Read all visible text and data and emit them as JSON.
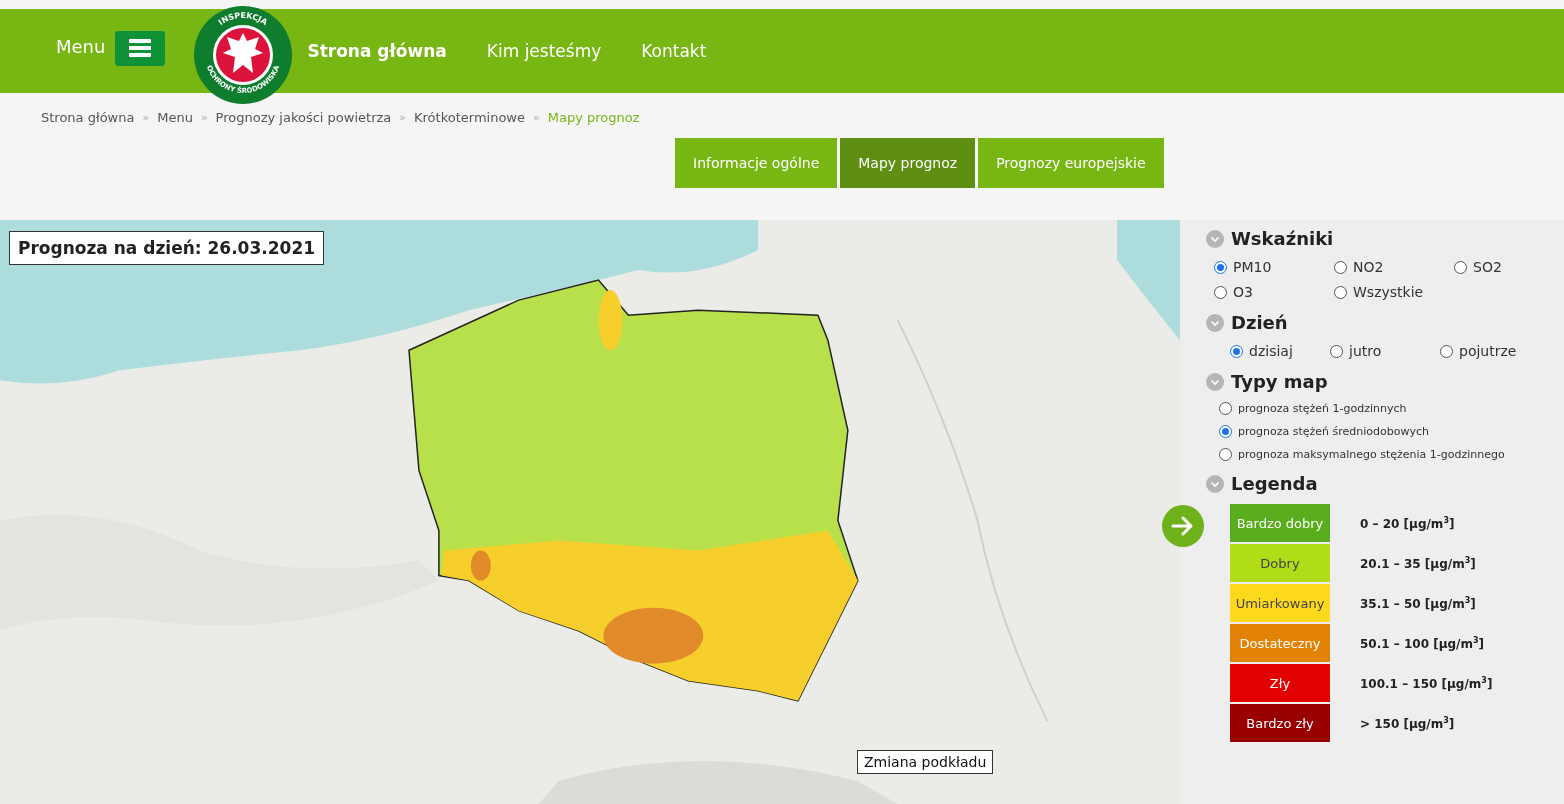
{
  "header": {
    "menu_label": "Menu",
    "logo": {
      "top_text": "INSPEKCJA",
      "bottom_text": "OCHRONY ŚRODOWISKA"
    },
    "nav": [
      {
        "label": "Strona główna",
        "selected": true
      },
      {
        "label": "Kim jesteśmy",
        "selected": false
      },
      {
        "label": "Kontakt",
        "selected": false
      }
    ]
  },
  "breadcrumb": [
    {
      "label": "Strona główna",
      "current": false
    },
    {
      "separator": "»",
      "label": "Menu",
      "current": false
    },
    {
      "separator": "»",
      "label": "Prognozy jakości powietrza",
      "current": false
    },
    {
      "separator": "»",
      "label": "Krótkoterminowe",
      "current": false
    },
    {
      "separator": "»",
      "label": "Mapy prognoz",
      "current": true
    }
  ],
  "tabs": [
    {
      "label": "Informacje ogólne",
      "selected": false
    },
    {
      "label": "Mapy prognoz",
      "selected": true
    },
    {
      "label": "Prognozy europejskie",
      "selected": false
    }
  ],
  "map": {
    "kind": "picture",
    "date_label": "Prognoza na dzień: 26.03.2021",
    "basemap_button": "Zmiana podkładu"
  },
  "panel": {
    "sections": [
      {
        "title": "Wskaźniki",
        "kind": "grid",
        "options": [
          {
            "label": "PM10",
            "selected": true
          },
          {
            "label": "NO2",
            "selected": false
          },
          {
            "label": "SO2",
            "selected": false
          },
          {
            "label": "O3",
            "selected": false
          },
          {
            "label": "Wszystkie",
            "selected": false
          }
        ]
      },
      {
        "title": "Dzień",
        "kind": "grid",
        "options": [
          {
            "label": "dzisiaj",
            "selected": true
          },
          {
            "label": "jutro",
            "selected": false
          },
          {
            "label": "pojutrze",
            "selected": false
          }
        ]
      },
      {
        "title": "Typy map",
        "kind": "list",
        "options": [
          {
            "label": "prognoza stężeń 1-godzinnych",
            "selected": false
          },
          {
            "label": "prognoza stężeń średniodobowych",
            "selected": true
          },
          {
            "label": "prognoza maksymalnego stężenia 1-godzinnego",
            "selected": false
          }
        ]
      },
      {
        "title": "Legenda",
        "kind": "legend",
        "items": [
          {
            "label": "Bardzo dobry",
            "color": "#5aad1c",
            "range": "0 – 20 [µg/m$^{3}$]"
          },
          {
            "label": "Dobry",
            "color": "#b0dc18",
            "range": "20.1 – 35 [µg/m$^{3}$]"
          },
          {
            "label": "Umiarkowany",
            "color": "#fcd91c",
            "range": "35.1 – 50 [µg/m$^{3}$]"
          },
          {
            "label": "Dostateczny",
            "color": "#e28206",
            "range": "50.1 – 100 [µg/m$^{3}$]"
          },
          {
            "label": "Zły",
            "color": "#e30000",
            "range": "100.1 – 150 [µg/m$^{3}$]"
          },
          {
            "label": "Bardzo zły",
            "color": "#990000",
            "range": "> 150 [µg/m$^{3}$]"
          }
        ]
      }
    ]
  }
}
